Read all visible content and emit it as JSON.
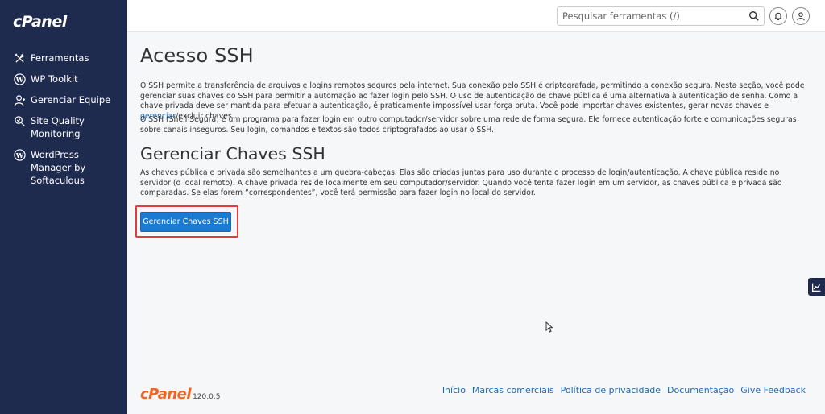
{
  "brand": {
    "logo_text": "cPanel"
  },
  "sidebar": {
    "items": [
      {
        "label": "Ferramentas",
        "icon": "tools-icon"
      },
      {
        "label": "WP Toolkit",
        "icon": "wordpress-icon"
      },
      {
        "label": "Gerenciar Equipe",
        "icon": "team-icon"
      },
      {
        "label": "Site Quality Monitoring",
        "icon": "site-quality-icon"
      },
      {
        "label": "WordPress Manager by Softaculous",
        "icon": "wordpress-icon"
      }
    ]
  },
  "header": {
    "search": {
      "placeholder": "Pesquisar ferramentas (/)",
      "value": ""
    }
  },
  "main": {
    "title": "Acesso SSH",
    "intro_p1": "O SSH permite a transferência de arquivos e logins remotos seguros pela internet. Sua conexão pelo SSH é criptografada, permitindo a conexão segura. Nesta seção, você pode gerenciar suas chaves do SSH para permitir a automação ao fazer login pelo SSH. O uso de autenticação de chave pública é uma alternativa à autenticação de senha. Como a chave privada deve ser mantida para efetuar a autenticação, é praticamente impossível usar força bruta. Você pode importar chaves existentes, gerar novas chaves e ",
    "intro_p1_link": "gerenciar",
    "intro_p1_end": "/excluir chaves.",
    "intro_p2": "O SSH (Shell Segura) é um programa para fazer login em outro computador/servidor sobre uma rede de forma segura. Ele fornece autenticação forte e comunicações seguras sobre canais inseguros. Seu login, comandos e textos são todos criptografados ao usar o SSH.",
    "section_title": "Gerenciar Chaves SSH",
    "section_text": "As chaves pública e privada são semelhantes a um quebra-cabeças. Elas são criadas juntas para uso durante o processo de login/autenticação. A chave pública reside no servidor (o local remoto). A chave privada reside localmente em seu computador/servidor. Quando você tenta fazer login em um servidor, as chaves pública e privada são comparadas. Se elas forem “correspondentes”, você terá permissão para fazer login no local do servidor.",
    "manage_button": "Gerenciar Chaves SSH"
  },
  "footer": {
    "brand": "cPanel",
    "version": "120.0.5",
    "links": [
      "Início",
      "Marcas comerciais",
      "Política de privacidade",
      "Documentação",
      "Give Feedback"
    ]
  },
  "colors": {
    "sidebar_bg": "#1f2a4f",
    "primary_button": "#1b7bd2",
    "highlight": "#e03c3c",
    "footer_brand": "#ee6722"
  }
}
